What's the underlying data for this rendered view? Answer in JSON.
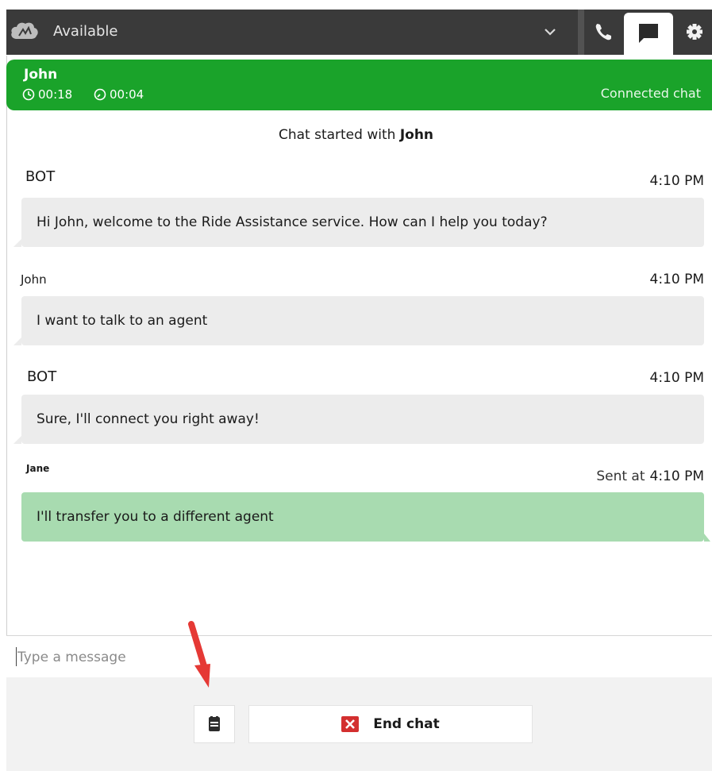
{
  "topbar": {
    "status": "Available",
    "colors": {
      "bar": "#3a3a3a"
    }
  },
  "contact": {
    "name": "John",
    "timer_total": "00:18",
    "timer_state": "00:04",
    "status": "Connected chat",
    "color": "#1aa32a"
  },
  "chat": {
    "started_prefix": "Chat started with",
    "started_name": "John",
    "messages": [
      {
        "sender": "BOT",
        "time": "4:10 PM",
        "text": "Hi John, welcome to the Ride Assistance service. How can I help you today?"
      },
      {
        "sender": "John",
        "time": "4:10 PM",
        "text": "I want to talk to an agent"
      },
      {
        "sender": "BOT",
        "time": "4:10 PM",
        "text": "Sure, I'll connect you right away!"
      },
      {
        "sender": "Jane",
        "time_prefix": "Sent at",
        "time": "4:10 PM",
        "text": "I'll transfer you to a different agent"
      }
    ]
  },
  "composer": {
    "placeholder": "Type a message"
  },
  "actions": {
    "end_chat_label": "End chat"
  }
}
